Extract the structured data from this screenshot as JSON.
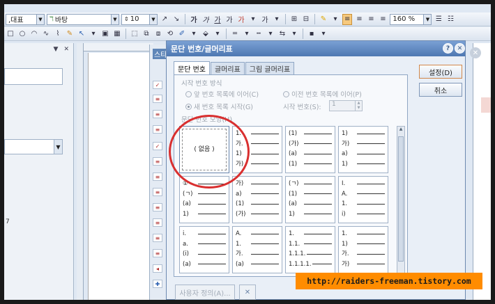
{
  "toolbar1": {
    "style_combo": ",대표",
    "font_combo": "바탕",
    "size_combo": "10",
    "zoom_combo": "160 %",
    "glyphs": [
      "가",
      "가",
      "가",
      "가",
      "가",
      "가",
      "가"
    ]
  },
  "left_panel": {
    "number_label": "7"
  },
  "style_panel": {
    "title": "스타"
  },
  "dialog": {
    "title": "문단 번호/글머리표",
    "tabs": [
      "문단 번호",
      "글머리표",
      "그림 글머리표"
    ],
    "start_group_label": "시작 번호 방식",
    "radio_prev_list": "앞 번호 목록에 이어(C)",
    "radio_prev_other": "이전 번호 목록에 이어(P)",
    "radio_new": "새 번호 목록 시작(G)",
    "start_number_label": "시작 번호(S):",
    "start_number_value": "1",
    "shape_group_label": "문단 번호 모양(H)",
    "none_label": "( 없음 )",
    "ok_label": "설정(D)",
    "cancel_label": "취소",
    "custom_label": "사용자 정의(A)..."
  },
  "patterns": [
    [
      [
        "1.",
        "가.",
        "1)",
        "가)"
      ]
    ],
    [
      [
        "(1)",
        "(가)",
        "(a)",
        "(1)"
      ]
    ],
    [
      [
        "1)",
        "가)",
        "a)",
        "1)"
      ]
    ],
    [
      [
        "①",
        "(ㄱ)",
        "(a)",
        "1)"
      ]
    ],
    [
      [
        "가)",
        "a)",
        "(1)",
        "(가)"
      ]
    ],
    [
      [
        "(ㄱ)",
        "(1)",
        "(a)",
        "1)"
      ]
    ],
    [
      [
        "I.",
        "A.",
        "1.",
        "i)"
      ]
    ],
    [
      [
        "i.",
        "a.",
        "(i)",
        "(a)"
      ]
    ],
    [
      [
        "A.",
        "1.",
        "가.",
        "(a)"
      ]
    ],
    [
      [
        "1.",
        "1.1.",
        "1.1.1.",
        "1.1.1.1."
      ]
    ],
    [
      [
        "1.",
        "1)",
        "가.",
        "가)"
      ]
    ]
  ],
  "watermark": "http://raiders-freeman.tistory.com",
  "colors": {
    "title_bar": "#4e78b2",
    "annotation_circle": "#d93030",
    "watermark_bg": "#ff8c00"
  }
}
